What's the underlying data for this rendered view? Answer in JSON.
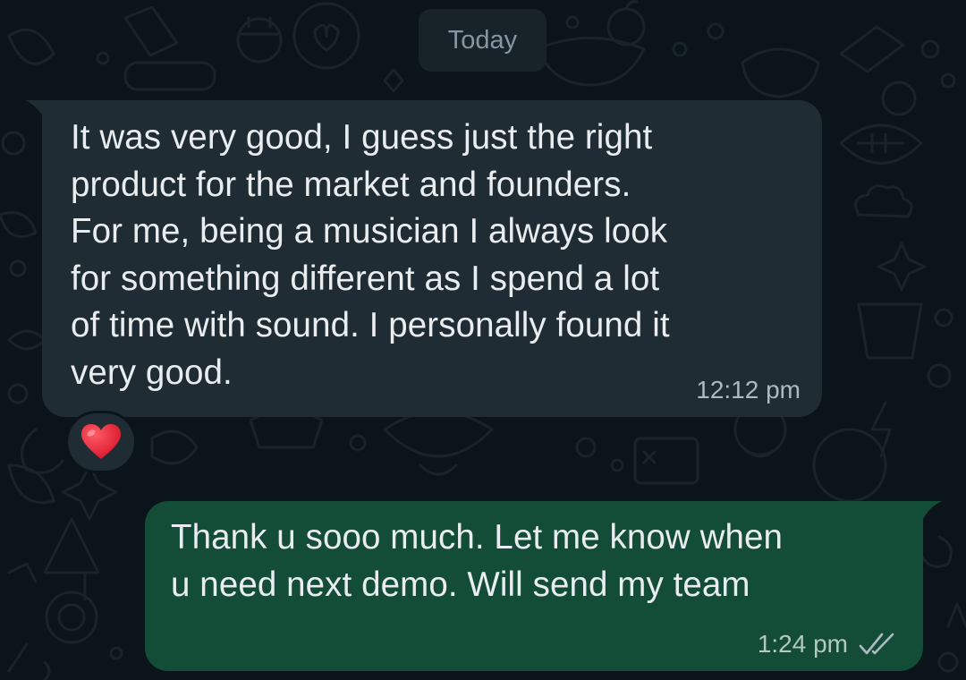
{
  "date_divider": "Today",
  "messages": [
    {
      "direction": "incoming",
      "text": "It was very good, I guess just the right\nproduct for the market and founders.\nFor me, being a musician I always look\nfor something different as I spend a lot\nof time with sound. I personally found it\nvery good.",
      "time": "12:12 pm",
      "reaction": "heart-emoji"
    },
    {
      "direction": "outgoing",
      "text": "Thank u sooo much. Let me know when\nu need next demo. Will send my team",
      "time": "1:24 pm",
      "status_icon": "double-check-icon"
    }
  ],
  "colors": {
    "background": "#0b141a",
    "incoming_bubble": "#202c33",
    "outgoing_bubble": "#144d37",
    "text": "#e9edef",
    "meta_text": "#aebac1"
  }
}
